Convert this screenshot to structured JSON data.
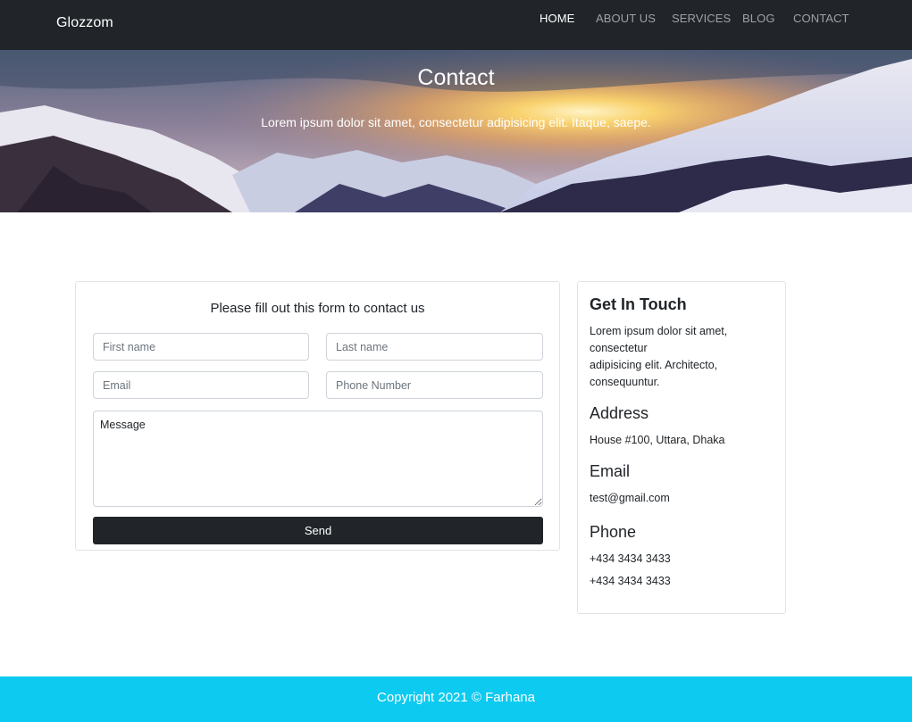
{
  "navbar": {
    "brand": "Glozzom",
    "links": [
      {
        "label": "HOME",
        "active": true
      },
      {
        "label": "ABOUT US",
        "active": false
      },
      {
        "label": "SERVICES",
        "active": false
      },
      {
        "label": "BLOG",
        "active": false
      },
      {
        "label": "CONTACT",
        "active": false
      }
    ]
  },
  "hero": {
    "title": "Contact",
    "subtitle": "Lorem ipsum dolor sit amet, consectetur adipisicing elit. Itaque, saepe."
  },
  "form": {
    "heading": "Please fill out this form to contact us",
    "first_name_placeholder": "First name",
    "last_name_placeholder": "Last name",
    "email_placeholder": "Email",
    "phone_placeholder": "Phone Number",
    "message_placeholder": "Message",
    "send_label": "Send"
  },
  "info": {
    "heading": "Get In Touch",
    "intro_line1": "Lorem ipsum dolor sit amet, consectetur",
    "intro_line2": "adipisicing elit. Architecto, consequuntur.",
    "address_heading": "Address",
    "address": "House #100, Uttara, Dhaka",
    "email_heading": "Email",
    "email": "test@gmail.com",
    "phone_heading": "Phone",
    "phones": [
      "+434 3434 3433",
      "+434 3434 3433"
    ]
  },
  "footer": {
    "copyright": "Copyright 2021 © Farhana"
  },
  "colors": {
    "navbar_bg": "#212529",
    "footer_bg": "#0dcaf0",
    "button_bg": "#212529",
    "nav_link": "#9ea2a7"
  }
}
